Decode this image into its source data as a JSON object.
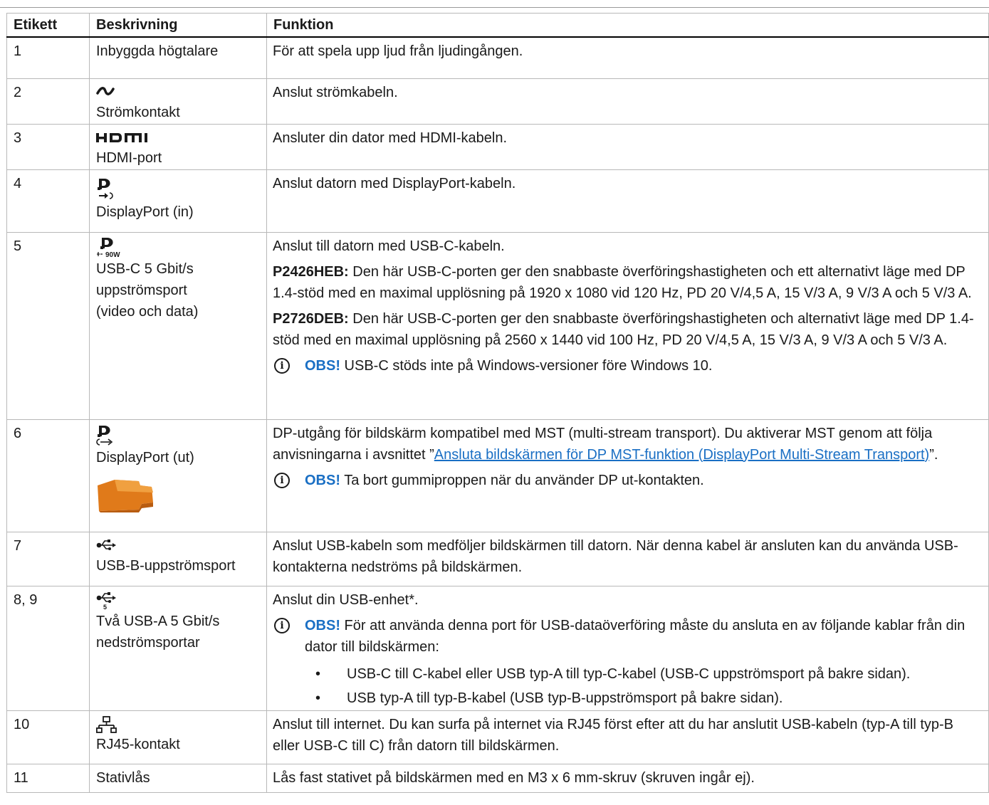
{
  "headers": {
    "etikett": "Etikett",
    "beskrivning": "Beskrivning",
    "funktion": "Funktion"
  },
  "rows": [
    {
      "label": "1",
      "description": "Inbyggda högtalare",
      "function": "För att spela upp ljud från ljudingången."
    },
    {
      "label": "2",
      "icon": "power-tilde-icon",
      "description": "Strömkontakt",
      "function": "Anslut strömkabeln."
    },
    {
      "label": "3",
      "icon": "hdmi-logo-icon",
      "description": "HDMI-port",
      "function": "Ansluter din dator med HDMI-kabeln."
    },
    {
      "label": "4",
      "icon": "displayport-in-icon",
      "description": "DisplayPort (in)",
      "function": "Anslut datorn med DisplayPort-kabeln."
    },
    {
      "label": "5",
      "icon": "displayport-usbc-90w-icon",
      "icon_text": "90W",
      "description_lines": [
        "USB-C 5 Gbit/s",
        "uppströmsport",
        "(video och data)"
      ],
      "function": "Anslut till datorn med USB-C-kabeln.",
      "p1_model": "P2426HEB:",
      "p1_text": " Den här USB-C-porten ger den snabbaste överföringshastigheten och ett alternativt läge med DP 1.4-stöd med en maximal upplösning på 1920 x 1080 vid 120 Hz, PD 20 V/4,5 A, 15 V/3 A, 9 V/3 A och 5 V/3 A.",
      "p2_model": "P2726DEB:",
      "p2_text": " Den här USB-C-porten ger den snabbaste överföringshastigheten och alternativt läge med DP 1.4-stöd med en maximal upplösning på 2560 x 1440 vid 100 Hz, PD 20 V/4,5 A, 15 V/3 A, 9 V/3 A och 5 V/3 A.",
      "note_label": "OBS!",
      "note_text": " USB-C stöds inte på Windows-versioner före Windows 10."
    },
    {
      "label": "6",
      "icon": "displayport-out-icon",
      "image": "rubber-plug-image",
      "description": "DisplayPort (ut)",
      "function_pre": "DP-utgång för bildskärm kompatibel med MST (multi-stream transport). Du aktiverar MST genom att följa anvisningarna i avsnittet ”",
      "function_link": "Ansluta bildskärmen för DP MST-funktion (DisplayPort Multi-Stream Transport)",
      "function_post": "”.",
      "note_label": "OBS!",
      "note_text": " Ta bort gummiproppen när du använder DP ut-kontakten."
    },
    {
      "label": "7",
      "icon": "usb-icon",
      "description": "USB-B-uppströmsport",
      "function": "Anslut USB-kabeln som medföljer bildskärmen till datorn. När denna kabel är ansluten kan du använda USB-kontakterna nedströms på bildskärmen."
    },
    {
      "label": "8, 9",
      "icon": "usb-5gbps-icon",
      "icon_text": "5",
      "description_lines": [
        "Två USB-A 5 Gbit/s",
        "nedströmsportar"
      ],
      "function": "Anslut din USB-enhet*.",
      "note_label": "OBS!",
      "note_text": " För att använda denna port för USB-dataöverföring måste du ansluta en av följande kablar från din dator till bildskärmen:",
      "bullets": [
        "USB-C till C-kabel eller USB typ-A till typ-C-kabel (USB-C uppströmsport på bakre sidan).",
        "USB typ-A till typ-B-kabel (USB typ-B-uppströmsport på bakre sidan)."
      ]
    },
    {
      "label": "10",
      "icon": "network-rj45-icon",
      "description": "RJ45-kontakt",
      "function": "Anslut till internet. Du kan surfa på internet via RJ45 först efter att du har anslutit USB-kabeln (typ-A till typ-B eller USB-C till C) från datorn till bildskärmen."
    },
    {
      "label": "11",
      "description": "Stativlås",
      "function": "Lås fast stativet på bildskärmen med en M3 x 6 mm-skruv (skruven ingår ej)."
    }
  ]
}
